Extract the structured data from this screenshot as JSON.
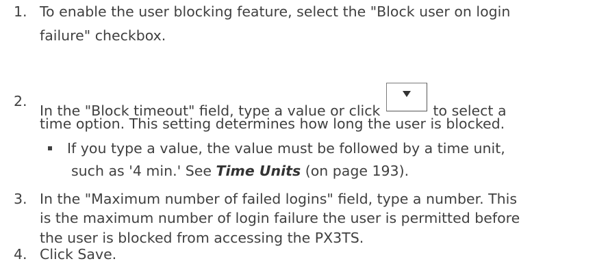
{
  "steps": [
    {
      "number": "1.",
      "line1": "To enable the user blocking feature, select the \"Block user on login",
      "line2": "failure\" checkbox."
    },
    {
      "number": "2.",
      "line1_before": "In the \"Block timeout\" field, type a value or click",
      "line1_after": "to select a",
      "line2": "time option. This setting determines how long the user is blocked.",
      "dropdown_icon": "chevron-down-icon",
      "bullet": {
        "line1": "If you type a value, the value must be followed by a time unit,",
        "line2_before": "such as '4 min.' See ",
        "link_text": "Time Units",
        "line2_after": " (on page 193)."
      }
    },
    {
      "number": "3.",
      "line1": "In the \"Maximum number of failed logins\" field, type a number. This",
      "line2": "is the maximum number of login failure the user is permitted before",
      "line3": "the user is blocked from accessing the PX3TS."
    },
    {
      "number": "4.",
      "line1": "Click Save."
    }
  ]
}
